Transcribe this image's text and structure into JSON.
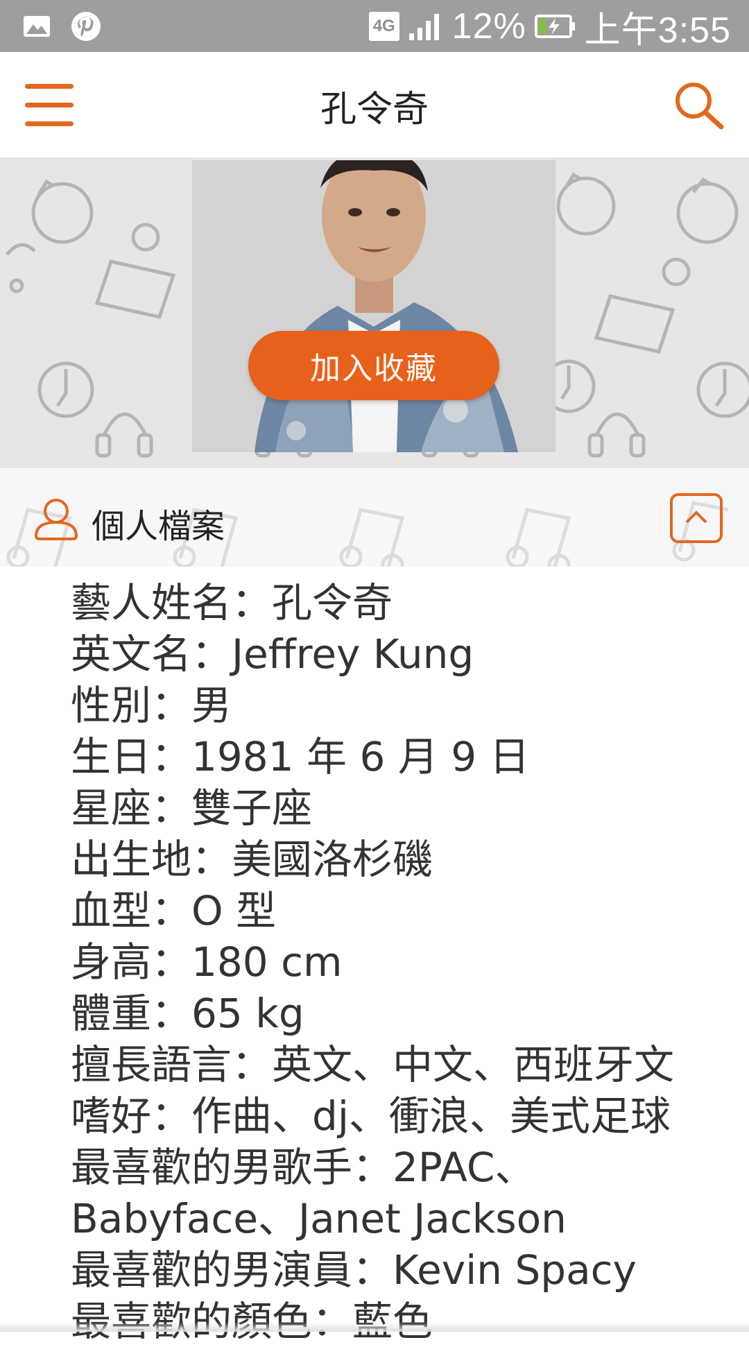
{
  "status_bar": {
    "network": "4G",
    "battery": "12%",
    "time": "上午3:55",
    "icons": [
      "gallery-icon",
      "pinterest-icon",
      "signal-icon",
      "battery-charging-icon"
    ]
  },
  "header": {
    "title": "孔令奇",
    "icons": [
      "menu-icon",
      "search-icon"
    ]
  },
  "hero": {
    "favorite_button": "加入收藏"
  },
  "profile_section": {
    "title": "個人檔案",
    "icons": [
      "profile-icon",
      "chevron-up-icon"
    ]
  },
  "profile": [
    "藝人姓名：孔令奇",
    "英文名：Jeffrey Kung",
    "性別：男",
    "生日：1981 年 6 月 9 日",
    "星座：雙子座",
    "出生地：美國洛杉磯",
    "血型：O 型",
    "身高：180 cm",
    "體重：65 kg",
    "擅長語言：英文、中文、西班牙文",
    "嗜好：作曲、dj、衝浪、美式足球",
    "最喜歡的男歌手：2PAC、Babyface、Janet Jackson",
    "最喜歡的男演員：Kevin Spacy",
    "最喜歡的顏色：藍色"
  ],
  "colors": {
    "accent": "#e8611b",
    "status_bar": "#9e9e9e"
  }
}
